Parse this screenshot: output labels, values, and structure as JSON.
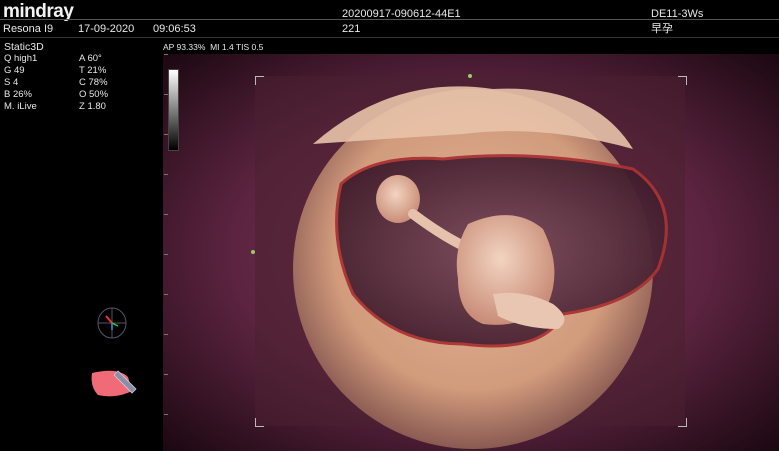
{
  "header": {
    "brand": "mindray",
    "device": "Resona I9",
    "date": "17-09-2020",
    "time": "09:06:53",
    "study_id": "20200917-090612-44E1",
    "sub_id": "221",
    "gest_age": "DE11-3Ws",
    "exam_type": "早孕"
  },
  "mode": "Static3D",
  "params": [
    {
      "left": "Q high1",
      "right": "A 60°"
    },
    {
      "left": "G 49",
      "right": "T 21%"
    },
    {
      "left": "S 4",
      "right": "C 78%"
    },
    {
      "left": "B 26%",
      "right": "O 50%"
    },
    {
      "left": "M. iLive",
      "right": "Z 1.80"
    }
  ],
  "safety": "AP 93.33%  MI 1.4 TIS 0.5",
  "colors": {
    "background": "#000000",
    "tissue": "#d9a688",
    "sac_outer": "#5a1f35",
    "fluid": "#6b3a4c"
  },
  "icons": [
    "3d-orientation-cube-icon",
    "transducer-probe-icon"
  ]
}
